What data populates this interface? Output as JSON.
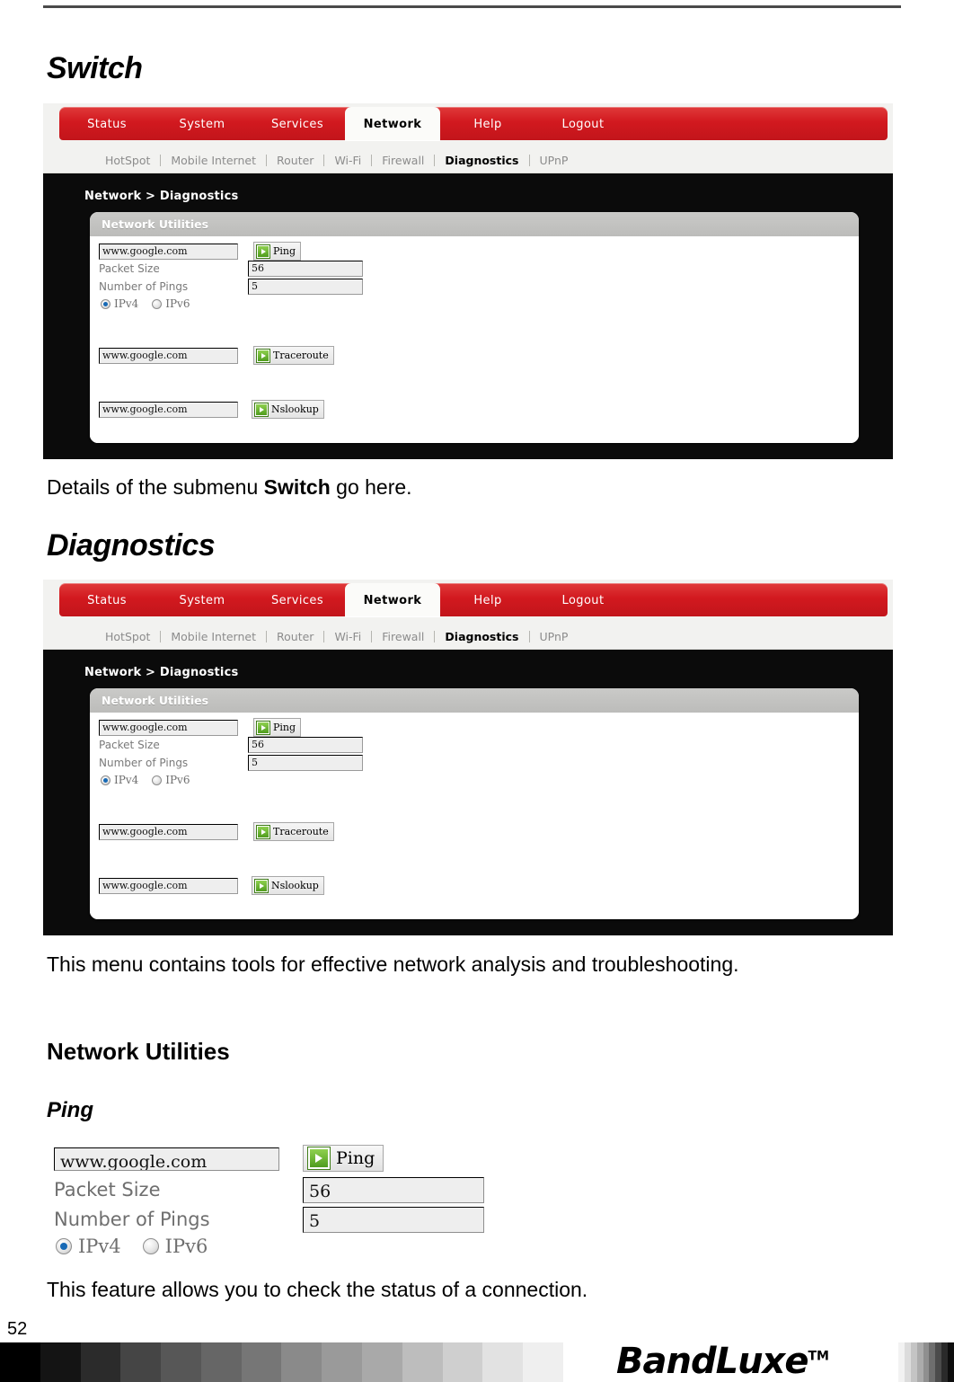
{
  "document": {
    "page_number": "52",
    "sections": [
      {
        "heading": "Switch",
        "caption_parts": [
          "Details of the submenu ",
          "Switch",
          " go here."
        ]
      },
      {
        "heading": "Diagnostics",
        "caption": "This menu contains tools for effective network analysis and troubleshooting."
      }
    ],
    "subheading_network_utilities": "Network Utilities",
    "subheading_ping": "Ping",
    "ping_caption": "This feature allows you to check the status of a connection."
  },
  "footer": {
    "brand": "BandLuxe",
    "trademark": "TM",
    "ramp_steps": [
      "#000000",
      "#141414",
      "#2b2b2b",
      "#454545",
      "#575757",
      "#666666",
      "#767676",
      "#8a8a8a",
      "#9a9a9a",
      "#a9a9a9",
      "#bdbdbd",
      "#cfcfcf",
      "#e2e2e2",
      "#efefef"
    ],
    "ramp_right_steps": [
      "#f2f2f2",
      "#dcdcdc",
      "#c4c4c4",
      "#ababab",
      "#8f8f8f",
      "#6e6e6e",
      "#4b4b4b",
      "#2a2a2a",
      "#0d0d0d"
    ]
  },
  "router_ui": {
    "brand_red": "#d2191f",
    "main_tabs": [
      {
        "label": "Status",
        "active": false
      },
      {
        "label": "System",
        "active": false
      },
      {
        "label": "Services",
        "active": false
      },
      {
        "label": "Network",
        "active": true
      },
      {
        "label": "Help",
        "active": false
      },
      {
        "label": "Logout",
        "active": false
      }
    ],
    "sub_tabs": [
      {
        "label": "HotSpot",
        "active": false
      },
      {
        "label": "Mobile Internet",
        "active": false
      },
      {
        "label": "Router",
        "active": false
      },
      {
        "label": "Wi-Fi",
        "active": false
      },
      {
        "label": "Firewall",
        "active": false
      },
      {
        "label": "Diagnostics",
        "active": true
      },
      {
        "label": "UPnP",
        "active": false
      }
    ],
    "breadcrumb": "Network > Diagnostics",
    "panel_title": "Network Utilities",
    "ping": {
      "host_value": "www.google.com",
      "button_label": "Ping",
      "packet_size_label": "Packet Size",
      "packet_size_value": "56",
      "number_of_pings_label": "Number of Pings",
      "number_of_pings_value": "5",
      "ipv4_label": "IPv4",
      "ipv6_label": "IPv6",
      "ip_version_selected": "IPv4"
    },
    "traceroute": {
      "host_value": "www.google.com",
      "button_label": "Traceroute"
    },
    "nslookup": {
      "host_value": "www.google.com",
      "button_label": "Nslookup"
    }
  }
}
